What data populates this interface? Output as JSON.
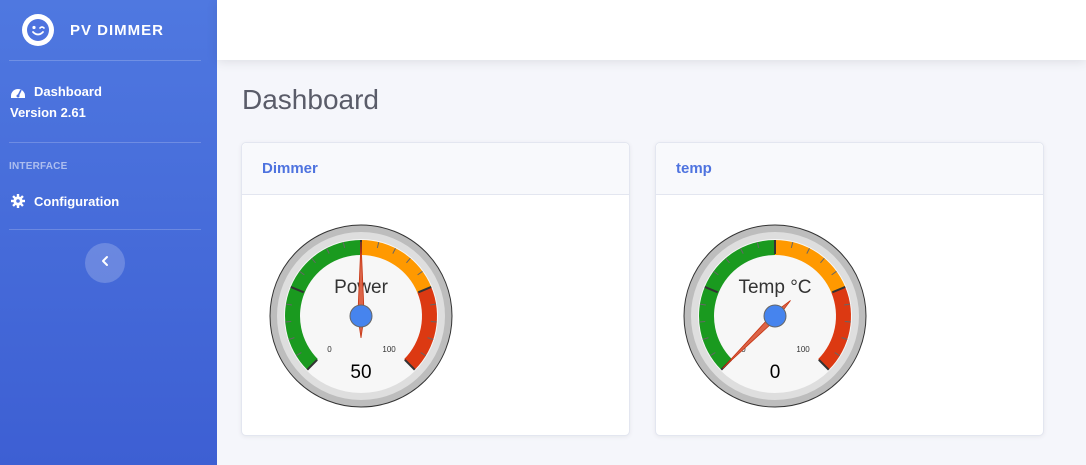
{
  "brand": {
    "name": "PV DIMMER",
    "icon": "smile-wink-icon"
  },
  "sidebar": {
    "dashboard": {
      "label": "Dashboard",
      "icon": "tachometer-icon",
      "version": "Version 2.61"
    },
    "heading": "INTERFACE",
    "configuration": {
      "label": "Configuration",
      "icon": "gear-icon"
    },
    "toggle_icon": "chevron-left-icon"
  },
  "page": {
    "title": "Dashboard"
  },
  "cards": [
    {
      "title": "Dimmer",
      "gauge": {
        "label": "Power",
        "value": 50,
        "min": 0,
        "max": 100,
        "min_label": "0",
        "max_label": "100"
      }
    },
    {
      "title": "temp",
      "gauge": {
        "label": "Temp °C",
        "value": 0,
        "min": 0,
        "max": 100,
        "min_label": "0",
        "max_label": "100"
      }
    }
  ],
  "colors": {
    "sidebar": "#4e73df",
    "green": "#1a9a1f",
    "orange": "#ff9900",
    "red": "#dc3912",
    "needle": "#dc6448",
    "hub": "#4684ee"
  }
}
